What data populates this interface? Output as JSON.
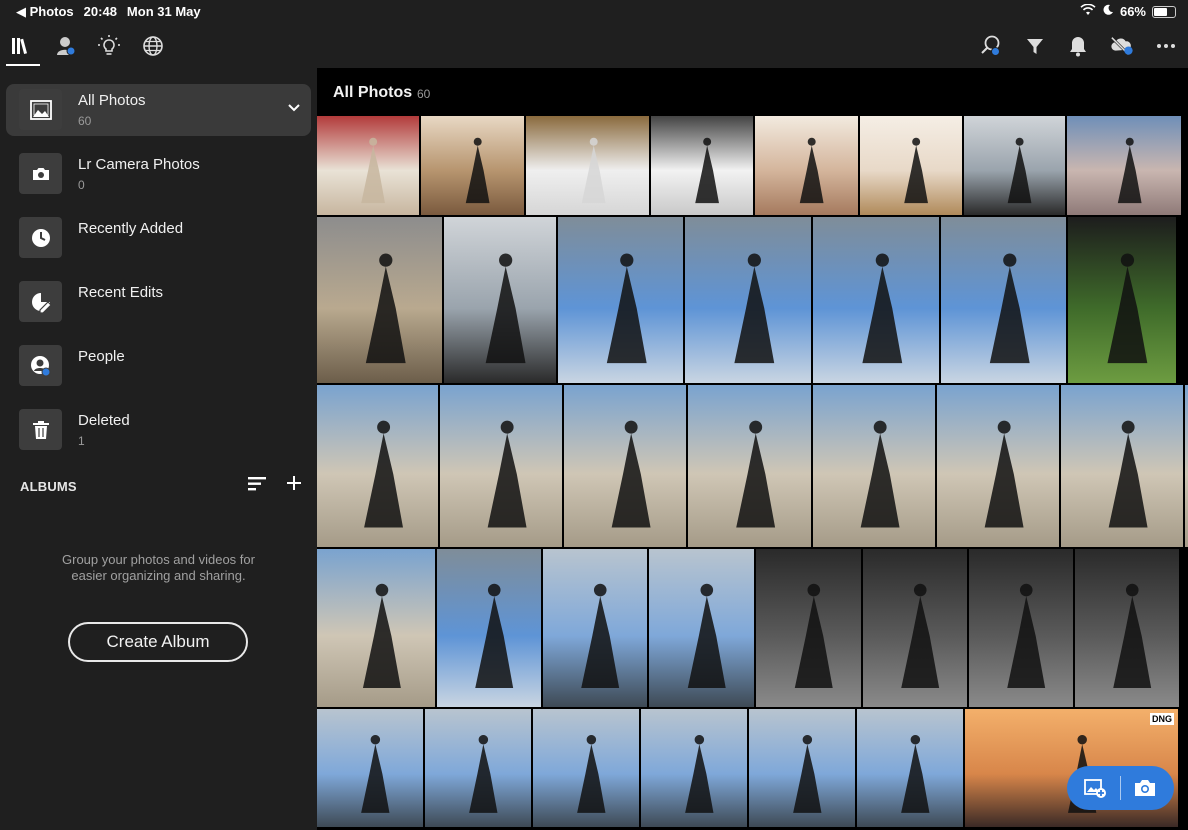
{
  "status_bar": {
    "back_label": "◀ Photos",
    "time": "20:48",
    "date": "Mon 31 May",
    "battery": "66%",
    "battery_level": 0.66
  },
  "toolbar": {
    "left_icons": [
      "library-icon",
      "people-badge-icon",
      "lightbulb-icon",
      "globe-icon"
    ],
    "right_icons": [
      "search-people-icon",
      "filter-icon",
      "bell-icon",
      "cloud-sync-icon",
      "more-icon"
    ]
  },
  "sidebar": {
    "items": [
      {
        "label": "All Photos",
        "count": "60",
        "icon": "photo-icon"
      },
      {
        "label": "Lr Camera Photos",
        "count": "0",
        "icon": "camera-icon"
      },
      {
        "label": "Recently Added",
        "count": "",
        "icon": "clock-icon"
      },
      {
        "label": "Recent Edits",
        "count": "",
        "icon": "edit-icon"
      },
      {
        "label": "People",
        "count": "",
        "icon": "people-icon"
      },
      {
        "label": "Deleted",
        "count": "1",
        "icon": "trash-icon"
      }
    ],
    "albums_header": "ALBUMS",
    "albums_empty_line1": "Group your photos and videos for",
    "albums_empty_line2": "easier organizing and sharing.",
    "create_album_label": "Create Album"
  },
  "main": {
    "title": "All Photos",
    "count": "60",
    "dng_badge": "DNG"
  },
  "colors": {
    "accent": "#2f7bdc",
    "sidebar_bg": "#1f1f1f",
    "active_item_bg": "#3a3a3a",
    "main_bg": "#000000"
  }
}
